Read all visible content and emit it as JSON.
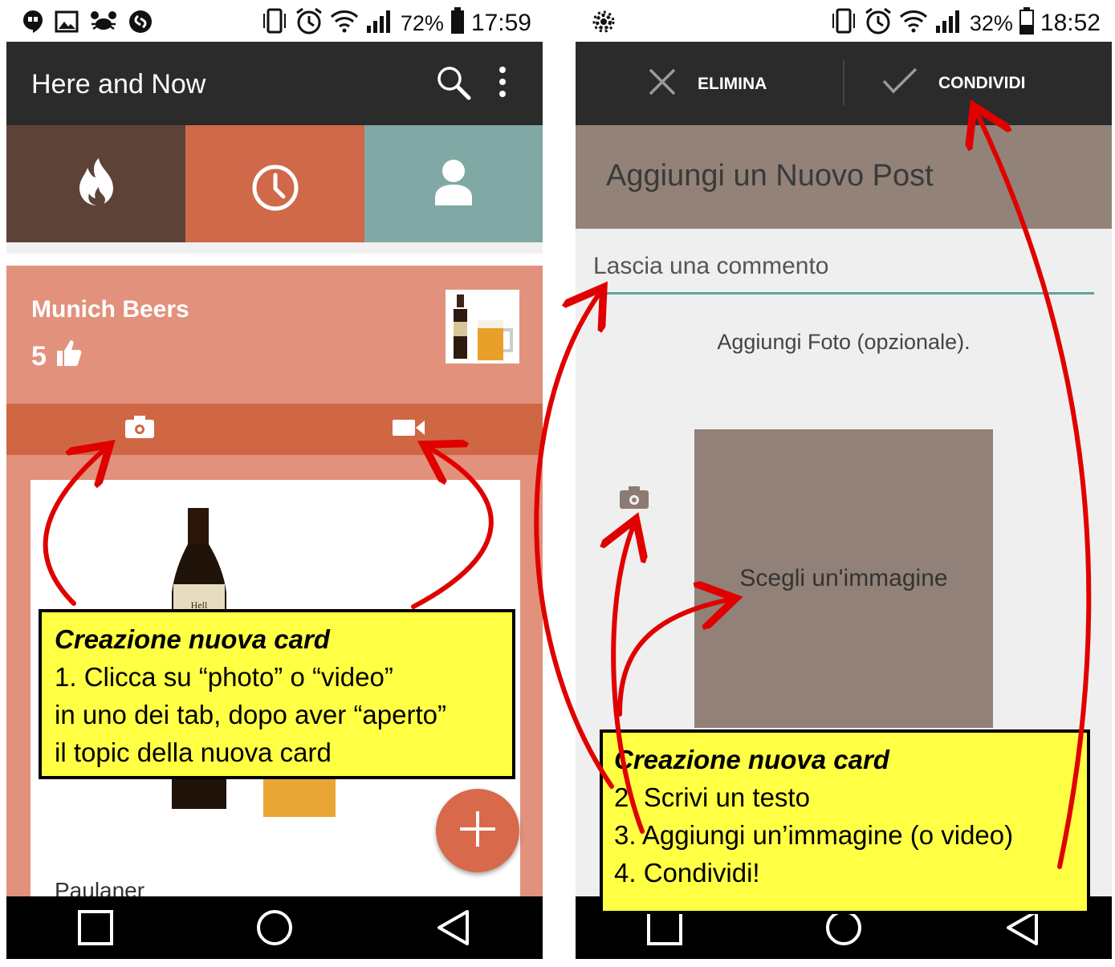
{
  "colors": {
    "appbar": "#2b2b2b",
    "tab_fire": "#5d4238",
    "tab_recent": "#d0684a",
    "tab_profile": "#80a9a5",
    "card_bg": "#e2917d",
    "media_bar": "#cf6745",
    "fab": "#d8694a",
    "header_brown": "#938278",
    "annotation_yellow": "#ffff44",
    "arrow_red": "#e00000",
    "underline_teal": "#5ea39b"
  },
  "screen1": {
    "status": {
      "battery": "72%",
      "time": "17:59"
    },
    "appbar": {
      "title": "Here and Now"
    },
    "tabs": [
      {
        "icon": "flame-icon"
      },
      {
        "icon": "clock-icon"
      },
      {
        "icon": "person-icon"
      }
    ],
    "card": {
      "title": "Munich Beers",
      "likes": "5",
      "media_buttons": [
        "camera-icon",
        "video-camera-icon"
      ],
      "item_label": "Paulaner"
    },
    "annotation": {
      "title": "Creazione nuova card",
      "lines": [
        "1.   Clicca su “photo” o “video”",
        "in uno dei tab, dopo aver “aperto”",
        "il topic della  nuova card"
      ]
    }
  },
  "screen2": {
    "status": {
      "battery": "32%",
      "time": "18:52"
    },
    "actionbar": {
      "delete_label": "ELIMINA",
      "share_label": "CONDIVIDI"
    },
    "header": {
      "title": "Aggiungi un Nuovo Post"
    },
    "comment_placeholder": "Lascia una commento",
    "add_photo_text": "Aggiungi Foto (opzionale).",
    "choose_image_text": "Scegli un'immagine",
    "annotation": {
      "title": "Creazione nuova card",
      "lines": [
        "2. Scrivi un testo",
        "3. Aggiungi un’immagine (o video)",
        "4. Condividi!"
      ]
    }
  }
}
